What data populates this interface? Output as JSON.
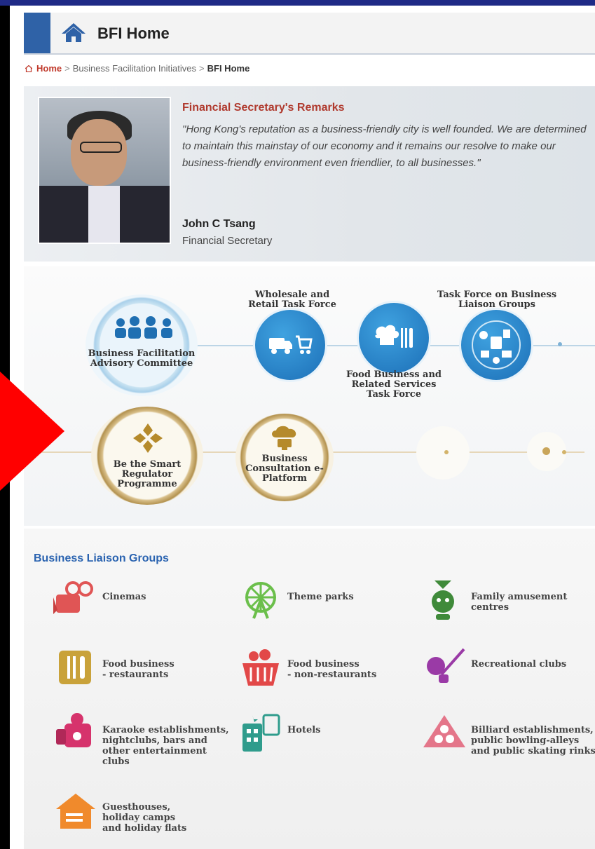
{
  "header": {
    "title": "BFI Home"
  },
  "breadcrumb": {
    "home": "Home",
    "separator": ">",
    "middle": "Business Facilitation Initiatives",
    "current": "BFI Home"
  },
  "remarks": {
    "heading": "Financial Secretary's Remarks",
    "quote": "\"Hong Kong's reputation as a business-friendly city is well founded. We are determined to maintain this mainstay of our economy and it remains our resolve to make our business-friendly environment even friendlier, to all businesses.\"",
    "name": "John C Tsang",
    "role": "Financial Secretary"
  },
  "diagram": {
    "bfac": "Business Facilitation Advisory Committee",
    "wholesale": "Wholesale and Retail Task Force",
    "food": "Food Business and Related Services Task Force",
    "liaison": "Task Force on Business Liaison Groups",
    "smart": "Be the Smart Regulator Programme",
    "consult": "Business Consultation e-Platform"
  },
  "liaison_groups": {
    "heading": "Business Liaison Groups",
    "items": [
      "Cinemas",
      "Theme parks",
      "Family amusement\ncentres",
      "Food business\n- restaurants",
      "Food business\n- non-restaurants",
      "Recreational clubs",
      "Karaoke establishments,\nnightclubs, bars and\nother entertainment\nclubs",
      "Hotels",
      "Billiard establishments,\npublic bowling-alleys\nand public skating rinks",
      "Guesthouses,\nholiday camps\nand holiday flats"
    ]
  },
  "colors": {
    "accent": "#2f62a7",
    "brand_red": "#c0392b",
    "link_blue": "#2a63b0",
    "overlay_arrow": "#ff0000"
  }
}
